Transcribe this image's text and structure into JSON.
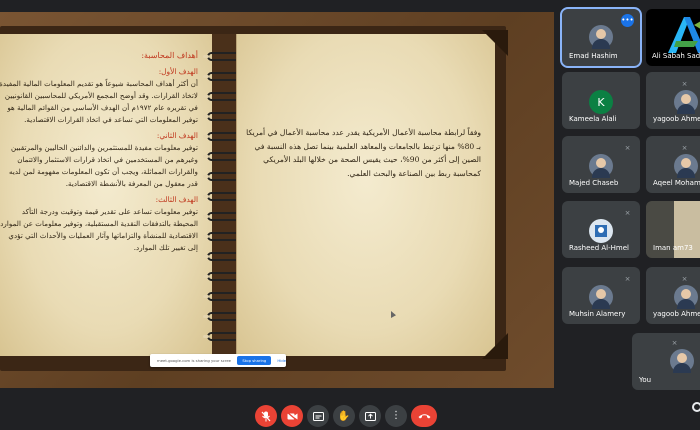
{
  "presentation": {
    "left_page": {
      "heading": "أهداف المحاسبة:",
      "sections": [
        {
          "title": "الهدف الأول:",
          "text": "أن أكثر أهداف المحاسبة شيوعاً هو تقديم المعلومات المالية المفيدة لاتخاذ القرارات. وقد أوضح المجمع الأمريكي للمحاسبين القانونيين في تقريره عام ١٩٧٢م أن الهدف الأساسي من القوائم المالية هو توفير المعلومات التي تساعد في اتخاذ القرارات الاقتصادية."
        },
        {
          "title": "الهدف الثاني:",
          "text": "توفير معلومات مفيدة للمستثمرين والدائنين الحاليين والمرتقبين وغيرهم من المستخدمين في اتخاذ قرارات الاستثمار والائتمان والقرارات المماثلة، ويجب أن تكون المعلومات مفهومة لمن لديه قدر معقول من المعرفة بالأنشطة الاقتصادية."
        },
        {
          "title": "الهدف الثالث:",
          "text": "توفير معلومات تساعد على تقدير قيمة وتوقيت ودرجة التأكد المحيطة بالتدفقات النقدية المستقبلية، وتوفير معلومات عن الموارد الاقتصادية للمنشأة والتزاماتها وآثار العمليات والأحداث التي تؤدي إلى تغيير تلك الموارد."
        }
      ]
    },
    "right_page": {
      "text": "وفقاً لرابطة محاسبة الأعمال الأمريكية يقدر عدد محاسبة الأعمال في أمريكا بـ 80% منها ترتبط بالجامعات والمعاهد العلمية بينما تصل هذه النسبة في الصين إلى أكثر من 90%، حيث يقيس الصحة من خلالها البلد الأمريكي كمحاسبة ربط بين الصناعة والبحث العلمي."
    },
    "share_banner": {
      "message": "meet.google.com is sharing your screen.",
      "stop_label": "Stop sharing",
      "hide_label": "Hide"
    }
  },
  "participants": [
    {
      "name": "Emad Hashim",
      "kind": "photo",
      "active": true,
      "more": "•••"
    },
    {
      "name": "Ali Sabah Sade",
      "kind": "logo"
    },
    {
      "name": "Kameela Alali",
      "kind": "initial",
      "initial": "K",
      "color": "#0b8043"
    },
    {
      "name": "yagoob Ahme",
      "kind": "photo",
      "muted": true
    },
    {
      "name": "Majed Chaseb",
      "kind": "photo",
      "muted": true
    },
    {
      "name": "Aqeel Moham",
      "kind": "photo",
      "muted": true
    },
    {
      "name": "Rasheed Al-Hmel",
      "kind": "photo",
      "muted": true
    },
    {
      "name": "Iman am73",
      "kind": "video"
    },
    {
      "name": "Muhsin Alamery",
      "kind": "photo",
      "muted": true
    },
    {
      "name": "yagoob Ahme",
      "kind": "photo",
      "muted": true
    },
    {
      "name": "You",
      "kind": "photo",
      "muted": true
    }
  ],
  "controls": {
    "mic": "microphone-off",
    "camera": "camera-off",
    "captions": "captions",
    "raise_hand": "raise-hand",
    "present": "present-screen",
    "more": "more-options",
    "leave": "leave-call"
  },
  "colors": {
    "background": "#202124",
    "tile": "#3c4043",
    "danger": "#ea4335",
    "accent": "#1a73e8",
    "heading_red": "#c0391f"
  }
}
